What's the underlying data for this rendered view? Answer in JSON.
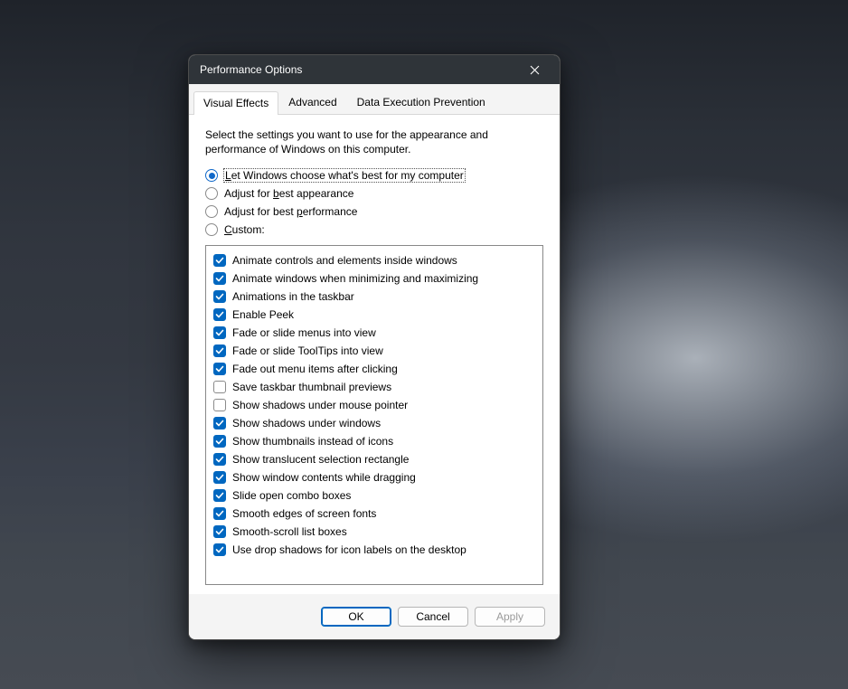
{
  "dialog": {
    "title": "Performance Options",
    "tabs": [
      {
        "label": "Visual Effects",
        "active": true
      },
      {
        "label": "Advanced",
        "active": false
      },
      {
        "label": "Data Execution Prevention",
        "active": false
      }
    ],
    "description": "Select the settings you want to use for the appearance and performance of Windows on this computer.",
    "radios": [
      {
        "label": "Let Windows choose what's best for my computer",
        "accel": "L",
        "checked": true,
        "focused": true
      },
      {
        "label": "Adjust for best appearance",
        "accel": "b",
        "checked": false,
        "focused": false
      },
      {
        "label": "Adjust for best performance",
        "accel": "p",
        "checked": false,
        "focused": false
      },
      {
        "label": "Custom:",
        "accel": "C",
        "checked": false,
        "focused": false
      }
    ],
    "effects": [
      {
        "label": "Animate controls and elements inside windows",
        "checked": true
      },
      {
        "label": "Animate windows when minimizing and maximizing",
        "checked": true
      },
      {
        "label": "Animations in the taskbar",
        "checked": true
      },
      {
        "label": "Enable Peek",
        "checked": true
      },
      {
        "label": "Fade or slide menus into view",
        "checked": true
      },
      {
        "label": "Fade or slide ToolTips into view",
        "checked": true
      },
      {
        "label": "Fade out menu items after clicking",
        "checked": true
      },
      {
        "label": "Save taskbar thumbnail previews",
        "checked": false
      },
      {
        "label": "Show shadows under mouse pointer",
        "checked": false
      },
      {
        "label": "Show shadows under windows",
        "checked": true
      },
      {
        "label": "Show thumbnails instead of icons",
        "checked": true
      },
      {
        "label": "Show translucent selection rectangle",
        "checked": true
      },
      {
        "label": "Show window contents while dragging",
        "checked": true
      },
      {
        "label": "Slide open combo boxes",
        "checked": true
      },
      {
        "label": "Smooth edges of screen fonts",
        "checked": true
      },
      {
        "label": "Smooth-scroll list boxes",
        "checked": true
      },
      {
        "label": "Use drop shadows for icon labels on the desktop",
        "checked": true
      }
    ],
    "buttons": {
      "ok": "OK",
      "cancel": "Cancel",
      "apply": "Apply"
    }
  }
}
